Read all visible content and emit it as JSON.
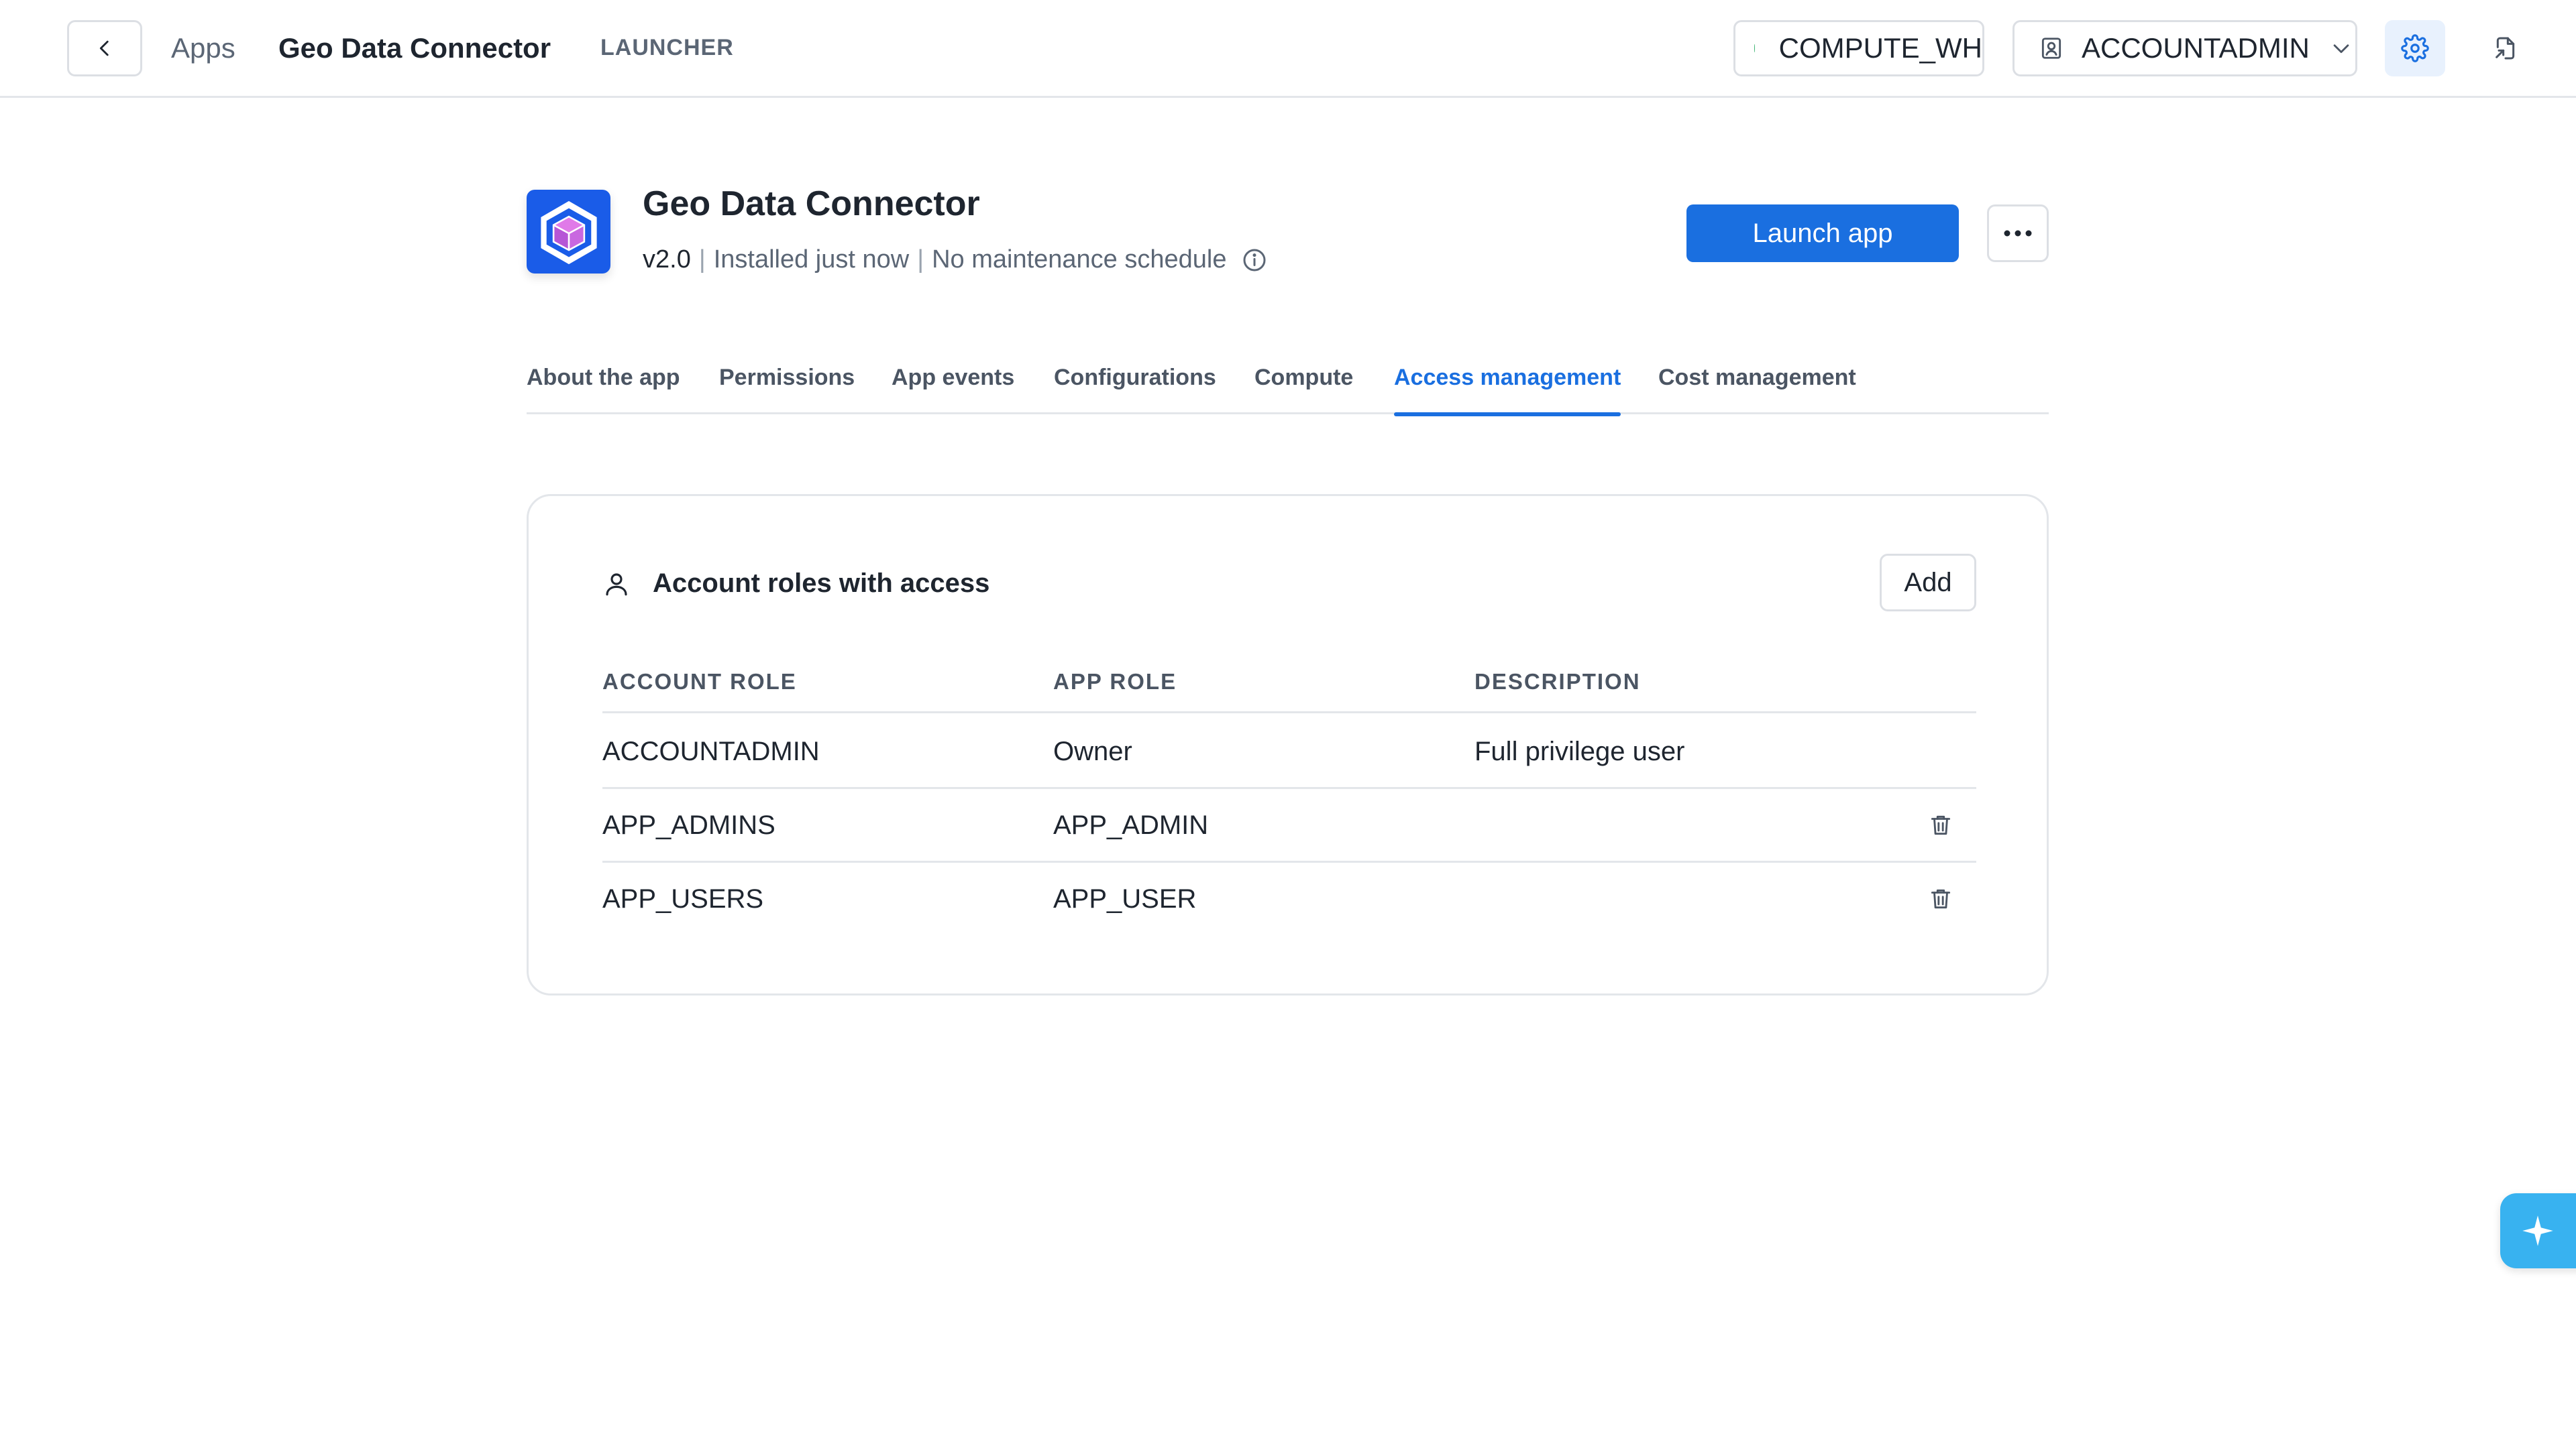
{
  "topbar": {
    "breadcrumb_apps": "Apps",
    "breadcrumb_app": "Geo Data Connector",
    "launcher": "LAUNCHER",
    "warehouse": "COMPUTE_WH",
    "role": "ACCOUNTADMIN"
  },
  "app": {
    "name": "Geo Data Connector",
    "version": "v2.0",
    "installed": "Installed just now",
    "maintenance": "No maintenance schedule",
    "launch_label": "Launch app"
  },
  "tabs": [
    {
      "label": "About the app"
    },
    {
      "label": "Permissions"
    },
    {
      "label": "App events"
    },
    {
      "label": "Configurations"
    },
    {
      "label": "Compute"
    },
    {
      "label": "Access management",
      "active": true
    },
    {
      "label": "Cost management"
    }
  ],
  "access": {
    "title": "Account roles with access",
    "add_label": "Add",
    "columns": [
      "ACCOUNT ROLE",
      "APP ROLE",
      "DESCRIPTION"
    ],
    "rows": [
      {
        "account_role": "ACCOUNTADMIN",
        "app_role": "Owner",
        "description": "Full privilege user",
        "deletable": false
      },
      {
        "account_role": "APP_ADMINS",
        "app_role": "APP_ADMIN",
        "description": "",
        "deletable": true
      },
      {
        "account_role": "APP_USERS",
        "app_role": "APP_USER",
        "description": "",
        "deletable": true
      }
    ]
  },
  "colors": {
    "accent": "#1a6fe0",
    "warehouse_status": "#3cb371",
    "logo_bg": "#1a5ce8",
    "fab": "#38b2f0"
  }
}
